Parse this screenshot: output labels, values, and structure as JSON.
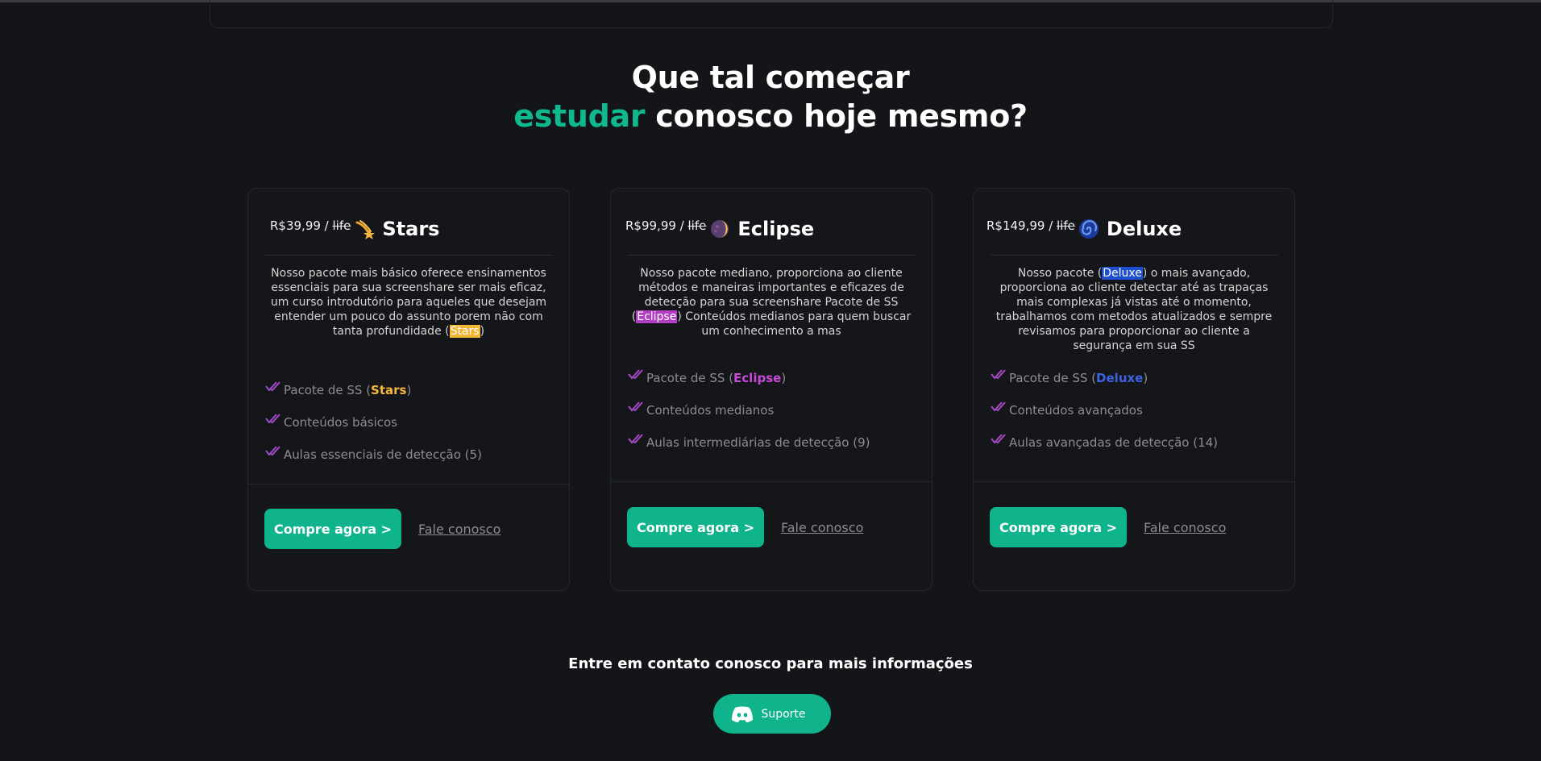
{
  "headline": {
    "line1": "Que tal começar",
    "accent": "estudar",
    "rest": " conosco hoje mesmo?"
  },
  "plans": [
    {
      "price": "R$39,99 / ",
      "period": "life",
      "name": "Stars",
      "icon": "shooting-star-icon",
      "accent_color": "#f5b73b",
      "desc_before": "Nosso pacote mais básico oferece ensinamentos essenciais para sua screenshare ser mais eficaz, um curso introdutório para aqueles que desejam entender um pouco do assunto porem não com tanta profundidade (",
      "desc_highlight": "Stars",
      "desc_after": ")",
      "feature1_prefix": "Pacote de SS (",
      "feature1_name": "Stars",
      "feature1_suffix": ")",
      "feature2": "Conteúdos básicos",
      "feature3": "Aulas essenciais de detecção (5)",
      "buy_label": "Compre agora >",
      "talk_label": "Fale conosco"
    },
    {
      "price": "R$99,99 / ",
      "period": "life",
      "name": "Eclipse",
      "icon": "crescent-moon-icon",
      "accent_color": "#c74bd6",
      "desc_before": "Nosso pacote mediano, proporciona ao cliente métodos e maneiras importantes e eficazes de detecção para sua screenshare Pacote de SS (",
      "desc_highlight": "Eclipse",
      "desc_after": ") Conteúdos medianos para quem buscar um conhecimento a mas",
      "feature1_prefix": "Pacote de SS (",
      "feature1_name": "Eclipse",
      "feature1_suffix": ")",
      "feature2": "Conteúdos medianos",
      "feature3": "Aulas intermediárias de detecção (9)",
      "buy_label": "Compre agora >",
      "talk_label": "Fale conosco"
    },
    {
      "price": "R$149,99 / ",
      "period": "life",
      "name": "Deluxe",
      "icon": "cyclone-icon",
      "accent_color": "#3d63e0",
      "desc_before": "Nosso pacote (",
      "desc_highlight": "Deluxe",
      "desc_after": ") o mais avançado, proporciona ao cliente detectar até as trapaças mais complexas já vistas até o momento, trabalhamos com metodos atualizados e sempre revisamos para proporcionar ao cliente a segurança em sua SS",
      "feature1_prefix": "Pacote de SS (",
      "feature1_name": "Deluxe",
      "feature1_suffix": ")",
      "feature2": "Conteúdos avançados",
      "feature3": "Aulas avançadas de detecção (14)",
      "buy_label": "Compre agora >",
      "talk_label": "Fale conosco"
    }
  ],
  "contact": {
    "text": "Entre em contato conosco para mais informações",
    "support_label": "Suporte",
    "support_icon": "discord-icon"
  }
}
